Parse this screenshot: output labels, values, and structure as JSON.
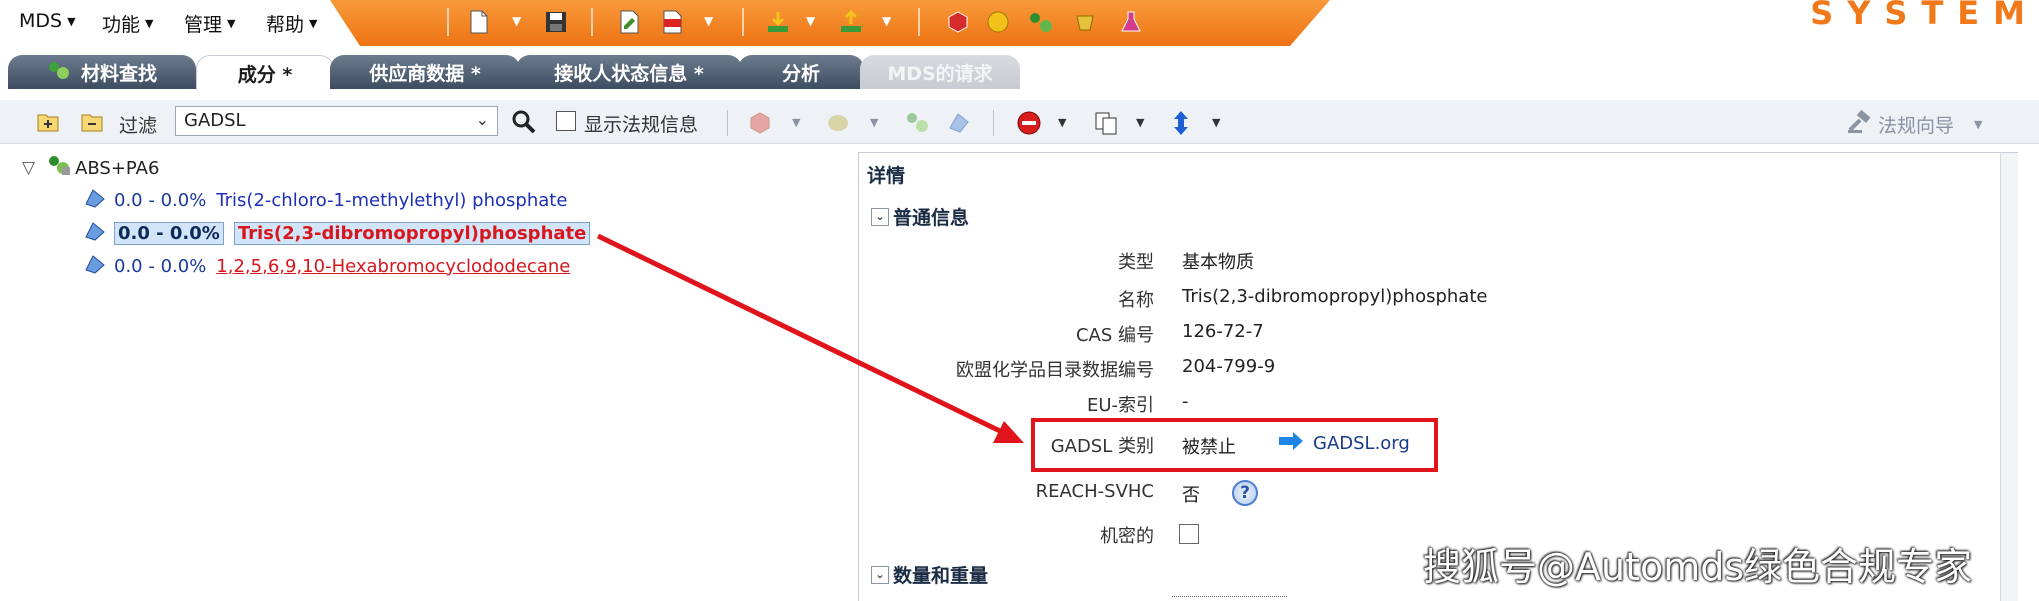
{
  "menubar": {
    "items": [
      {
        "label": "MDS"
      },
      {
        "label": "功能"
      },
      {
        "label": "管理"
      },
      {
        "label": "帮助"
      }
    ],
    "brand": "SYSTEM",
    "accent_color": "#f07a1a"
  },
  "tabs": [
    {
      "label": "材料查找",
      "icon": "material-search-icon",
      "state": "inactive"
    },
    {
      "label": "成分 *",
      "state": "active"
    },
    {
      "label": "供应商数据 *",
      "state": "inactive"
    },
    {
      "label": "接收人状态信息 *",
      "state": "inactive"
    },
    {
      "label": "分析",
      "state": "inactive"
    },
    {
      "label": "MDS的请求",
      "state": "disabled"
    }
  ],
  "filterbar": {
    "filter_label": "过滤",
    "filter_value": "GADSL",
    "show_regulations_label": "显示法规信息",
    "show_regulations_checked": false,
    "wizard_label": "法规向导"
  },
  "tree": {
    "root_label": "ABS+PA6",
    "rows": [
      {
        "pct": "0.0 - 0.0%",
        "substance": "Tris(2-chloro-1-methylethyl) phosphate",
        "selected": false,
        "style": "blue"
      },
      {
        "pct": "0.0 - 0.0%",
        "substance": "Tris(2,3-dibromopropyl)phosphate",
        "selected": true,
        "style": "red-bold"
      },
      {
        "pct": "0.0 - 0.0%",
        "substance": "1,2,5,6,9,10-Hexabromocyclododecane",
        "selected": false,
        "style": "red-underline"
      }
    ]
  },
  "details": {
    "title": "详情",
    "general_section": "普通信息",
    "fields": [
      {
        "label": "类型",
        "value": "基本物质"
      },
      {
        "label": "名称",
        "value": "Tris(2,3-dibromopropyl)phosphate"
      },
      {
        "label": "CAS 编号",
        "value": "126-72-7"
      },
      {
        "label": "欧盟化学品目录数据编号",
        "value": "204-799-9"
      },
      {
        "label": "EU-索引",
        "value": "-"
      },
      {
        "label": "GADSL 类别",
        "value": "被禁止"
      },
      {
        "label": "REACH-SVHC",
        "value": "否"
      },
      {
        "label": "机密的",
        "value": ""
      }
    ],
    "gadsl_link": "GADSL.org",
    "help_symbol": "?",
    "quantity_section": "数量和重量"
  },
  "annotation": {
    "highlight_color": "#e0141b"
  },
  "watermark": "搜狐号@Automds绿色合规专家"
}
